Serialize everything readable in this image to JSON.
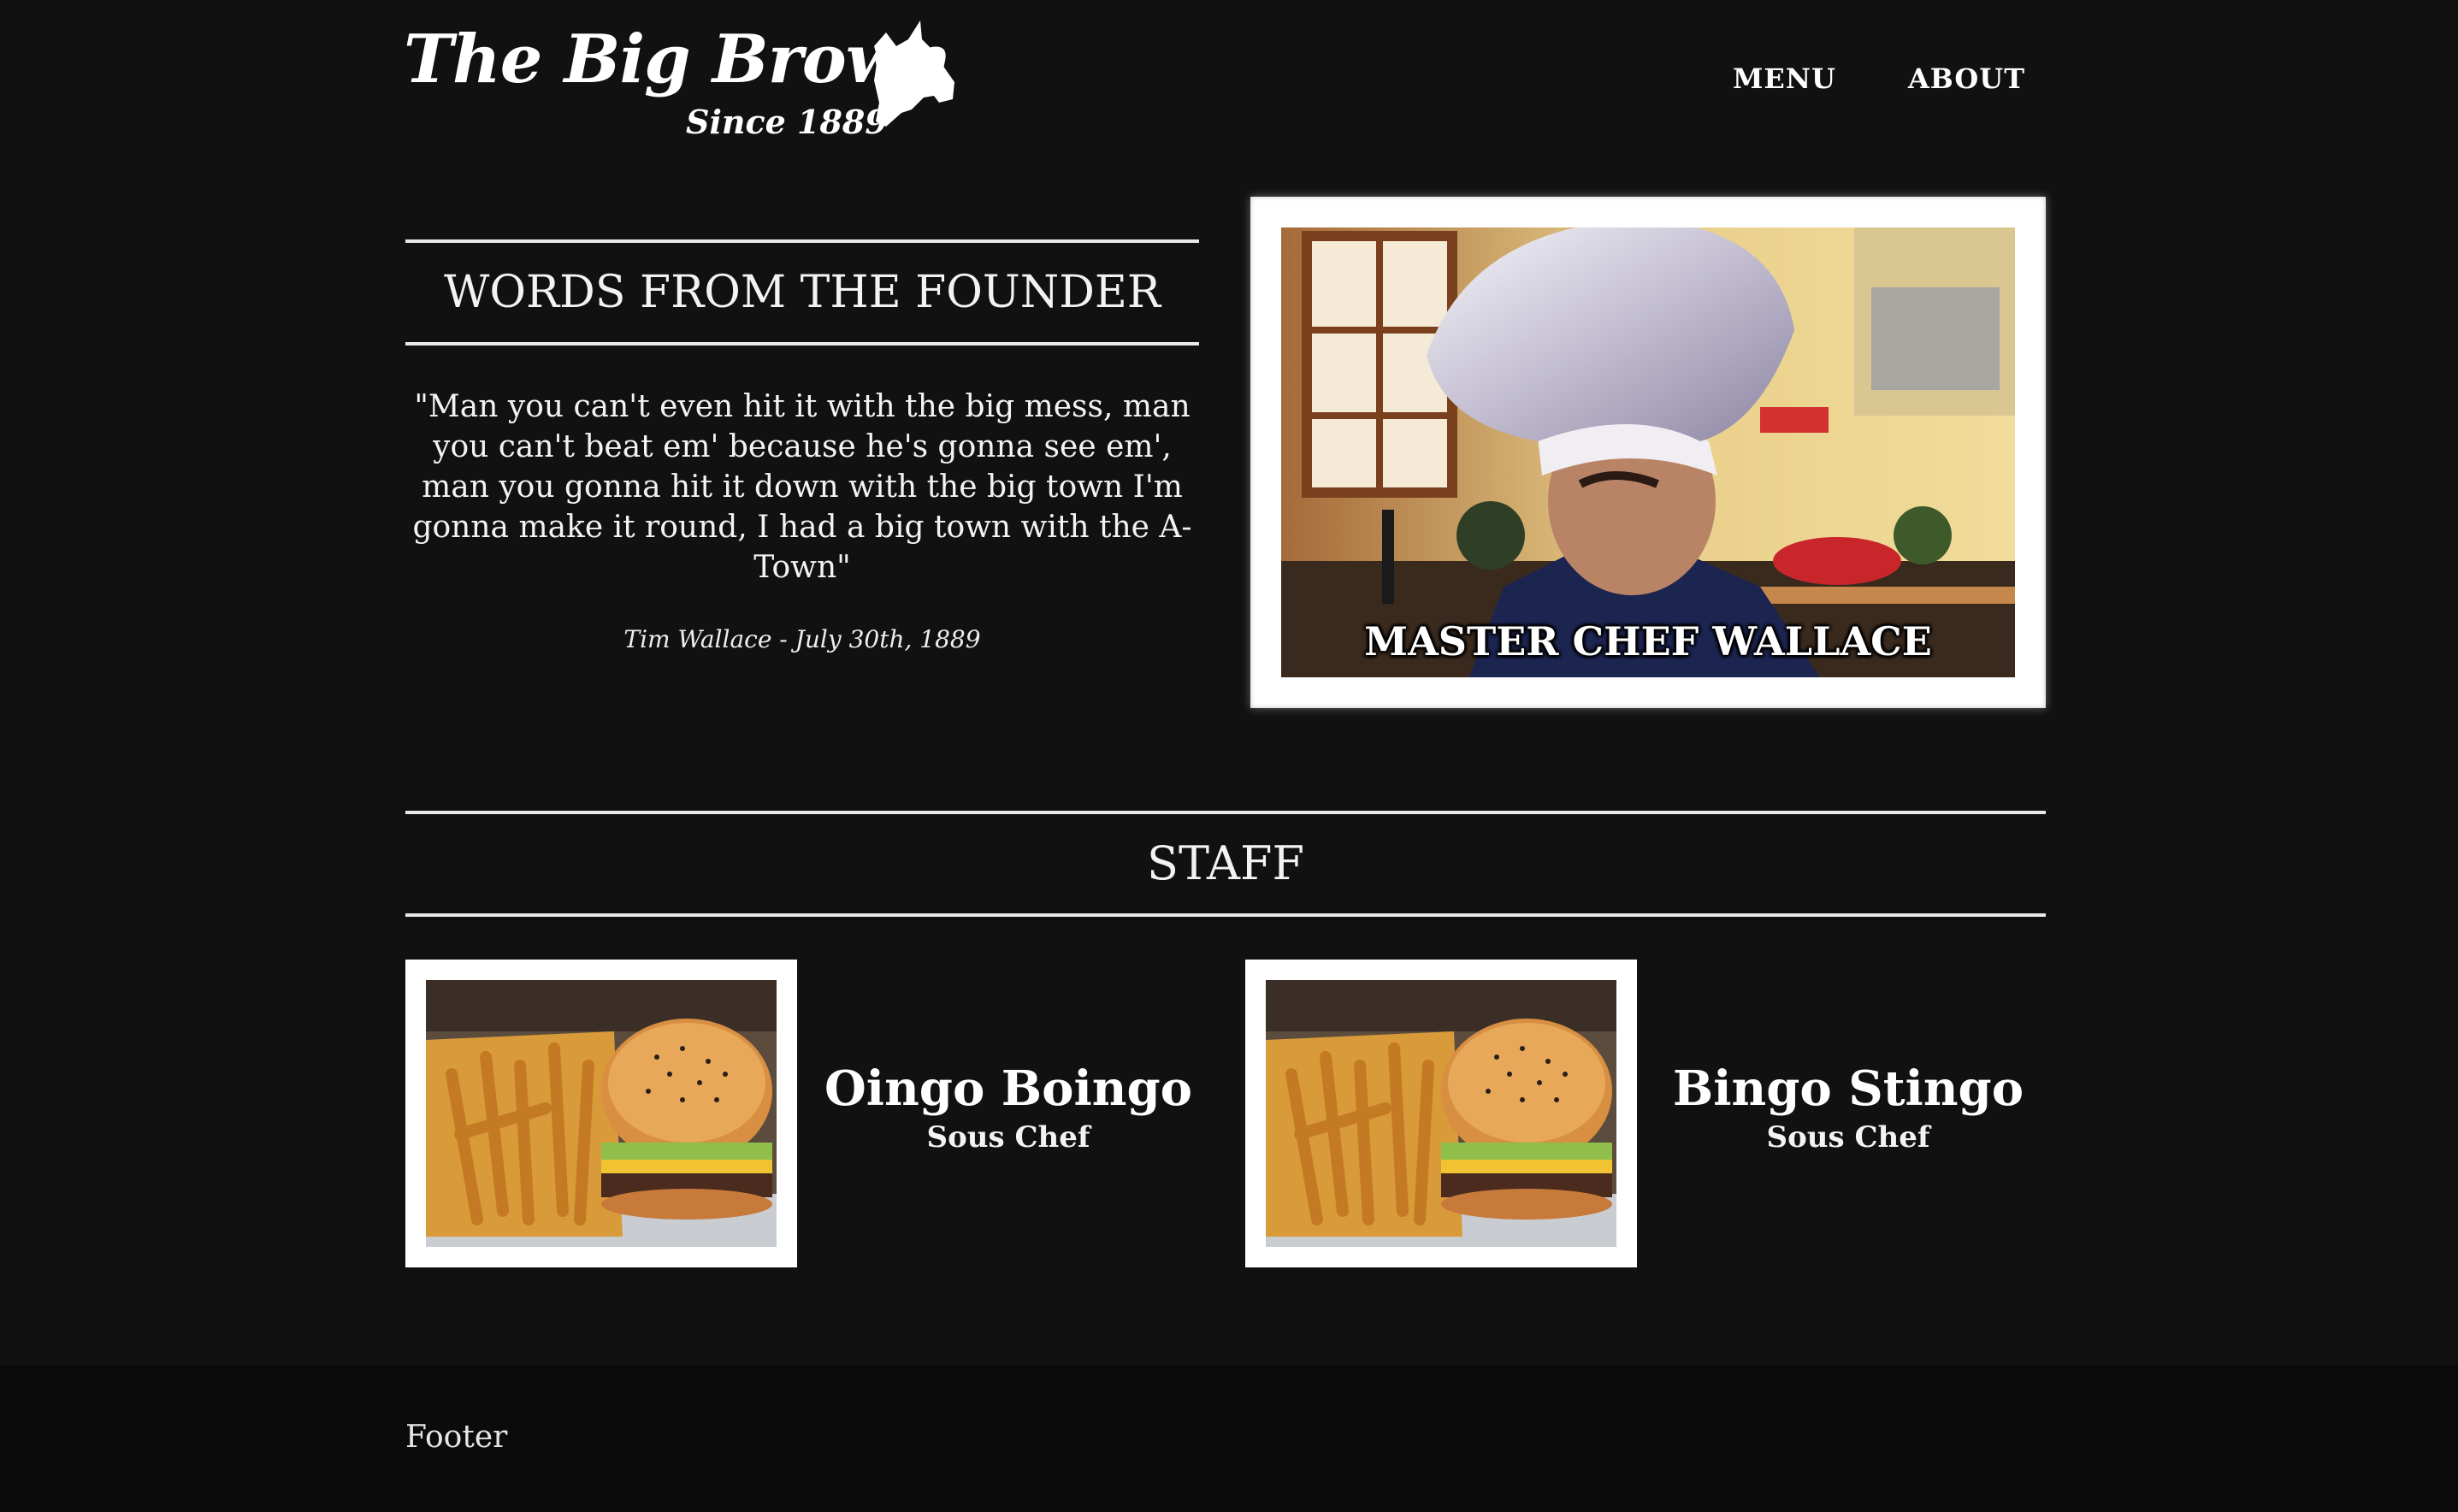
{
  "brand": {
    "title": "The Big Brown",
    "subtitle": "Since 1889",
    "mascot_icon": "cow-head-icon"
  },
  "nav": {
    "items": [
      {
        "label": "MENU"
      },
      {
        "label": "ABOUT"
      }
    ]
  },
  "founder": {
    "heading": "WORDS FROM THE FOUNDER",
    "quote": "\"Man you can't even hit it with the big mess, man you can't beat em' because he's gonna see em', man you gonna hit it down with the big town I'm gonna make it round, I had a big town with the A-Town\"",
    "attribution": "Tim Wallace - July 30th, 1889",
    "image_caption": "MASTER CHEF WALLACE"
  },
  "staff": {
    "heading": "STAFF",
    "members": [
      {
        "name": "Oingo Boingo",
        "role": "Sous Chef"
      },
      {
        "name": "Bingo Stingo",
        "role": "Sous Chef"
      }
    ]
  },
  "footer": {
    "text": "Footer"
  },
  "colors": {
    "background": "#111111",
    "footer_background": "#0b0b0b",
    "text": "#f3f3f3",
    "rule": "#e9e9e9",
    "frame": "#ffffff"
  }
}
